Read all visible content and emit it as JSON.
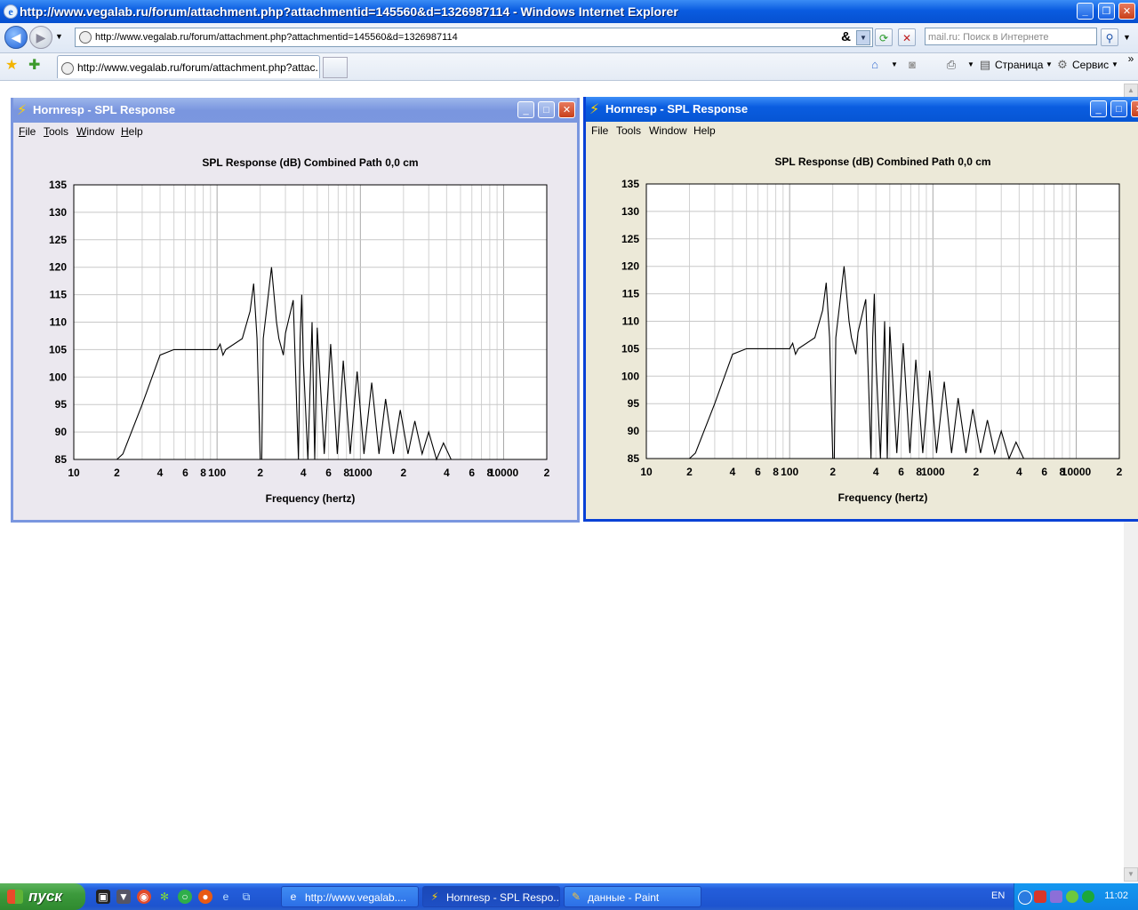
{
  "browser": {
    "title": "http://www.vegalab.ru/forum/attachment.php?attachmentid=145560&d=1326987114 - Windows Internet Explorer",
    "address": "http://www.vegalab.ru/forum/attachment.php?attachmentid=145560&d=1326987114",
    "search_placeholder": "mail.ru: Поиск в Интернете",
    "tab_label": "http://www.vegalab.ru/forum/attachment.php?attac...",
    "cmd_page": "Страница",
    "cmd_tools": "Сервис"
  },
  "windows": [
    {
      "title": "Hornresp - SPL Response",
      "menu": [
        "File",
        "Tools",
        "Window",
        "Help"
      ]
    },
    {
      "title": "Hornresp - SPL Response",
      "menu": [
        "File",
        "Tools",
        "Window",
        "Help"
      ]
    }
  ],
  "chart_data": [
    {
      "type": "line",
      "title": "SPL Response (dB)   Combined   Path 0,0 cm",
      "xlabel": "Frequency (hertz)",
      "ylabel": "",
      "x_scale": "log",
      "xlim": [
        10,
        20000
      ],
      "ylim": [
        85,
        135
      ],
      "yticks": [
        "135",
        "130",
        "125",
        "120",
        "115",
        "110",
        "105",
        "100",
        "95",
        "90",
        "85"
      ],
      "xtick_labels": [
        "10",
        "2",
        "4",
        "6",
        "8",
        "100",
        "2",
        "4",
        "6",
        "8",
        "1000",
        "2",
        "4",
        "6",
        "8",
        "10000",
        "2"
      ],
      "grid": true,
      "series": [
        {
          "x": [
            10,
            20,
            22,
            30,
            40,
            50,
            60,
            80,
            100,
            105,
            110,
            115,
            150,
            170,
            180,
            190,
            200,
            205,
            210,
            240,
            260,
            270,
            290,
            300,
            340,
            370,
            380,
            390,
            400,
            430,
            460,
            480,
            500,
            560,
            620,
            690,
            760,
            850,
            950,
            1060,
            1200,
            1350,
            1500,
            1700,
            1900,
            2150,
            2400,
            2700,
            3000,
            3400,
            3800,
            4300
          ],
          "y": [
            85,
            85,
            86,
            95,
            104,
            105,
            105,
            105,
            105,
            106,
            104,
            105,
            107,
            112,
            117,
            107,
            85,
            85,
            107,
            120,
            110,
            107,
            104,
            108,
            114,
            85,
            107,
            115,
            103,
            85,
            110,
            85,
            109,
            86,
            106,
            86,
            103,
            86,
            101,
            86,
            99,
            86,
            96,
            86,
            94,
            86,
            92,
            86,
            90,
            85,
            88,
            85
          ]
        }
      ]
    },
    {
      "type": "line",
      "title": "SPL Response (dB)   Combined   Path 0,0 cm",
      "xlabel": "Frequency (hertz)",
      "ylabel": "",
      "x_scale": "log",
      "xlim": [
        10,
        20000
      ],
      "ylim": [
        85,
        135
      ],
      "yticks": [
        "135",
        "130",
        "125",
        "120",
        "115",
        "110",
        "105",
        "100",
        "95",
        "90",
        "85"
      ],
      "xtick_labels": [
        "10",
        "2",
        "4",
        "6",
        "8",
        "100",
        "2",
        "4",
        "6",
        "8",
        "1000",
        "2",
        "4",
        "6",
        "8",
        "10000",
        "2"
      ],
      "grid": true,
      "series": [
        {
          "x": [
            10,
            20,
            22,
            30,
            40,
            50,
            60,
            80,
            100,
            105,
            110,
            115,
            150,
            170,
            180,
            190,
            200,
            205,
            210,
            240,
            260,
            270,
            290,
            300,
            340,
            370,
            380,
            390,
            400,
            430,
            460,
            480,
            500,
            560,
            620,
            690,
            760,
            850,
            950,
            1060,
            1200,
            1350,
            1500,
            1700,
            1900,
            2150,
            2400,
            2700,
            3000,
            3400,
            3800,
            4300
          ],
          "y": [
            85,
            85,
            86,
            95,
            104,
            105,
            105,
            105,
            105,
            106,
            104,
            105,
            107,
            112,
            117,
            107,
            85,
            85,
            107,
            120,
            110,
            107,
            104,
            108,
            114,
            85,
            107,
            115,
            103,
            85,
            110,
            85,
            109,
            86,
            106,
            86,
            103,
            86,
            101,
            86,
            99,
            86,
            96,
            86,
            94,
            86,
            92,
            86,
            90,
            85,
            88,
            85
          ]
        }
      ]
    }
  ],
  "taskbar": {
    "start_label": "пуск",
    "tasks": [
      "http://www.vegalab....",
      "Hornresp - SPL Respo...",
      "данные - Paint"
    ],
    "lang": "EN",
    "clock": "11:02"
  }
}
